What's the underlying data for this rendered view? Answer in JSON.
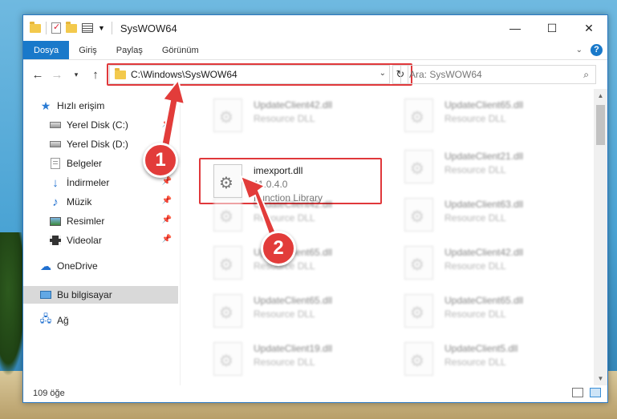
{
  "window": {
    "title": "SysWOW64",
    "minimize": "—",
    "maximize": "☐",
    "close": "✕"
  },
  "ribbon": {
    "tabs": [
      "Dosya",
      "Giriş",
      "Paylaş",
      "Görünüm"
    ]
  },
  "nav": {
    "address": "C:\\Windows\\SysWOW64",
    "search_placeholder": "Ara: SysWOW64"
  },
  "sidebar": {
    "items": [
      {
        "label": "Hızlı erişim",
        "icon": "star-icon"
      },
      {
        "label": "Yerel Disk (C:)",
        "icon": "disk-icon"
      },
      {
        "label": "Yerel Disk (D:)",
        "icon": "disk-icon"
      },
      {
        "label": "Belgeler",
        "icon": "documents-icon"
      },
      {
        "label": "İndirmeler",
        "icon": "downloads-icon"
      },
      {
        "label": "Müzik",
        "icon": "music-icon"
      },
      {
        "label": "Resimler",
        "icon": "pictures-icon"
      },
      {
        "label": "Videolar",
        "icon": "videos-icon"
      },
      {
        "label": "OneDrive",
        "icon": "cloud-icon"
      },
      {
        "label": "Bu bilgisayar",
        "icon": "computer-icon"
      },
      {
        "label": "Ağ",
        "icon": "network-icon"
      }
    ]
  },
  "files": {
    "left": [
      {
        "name": "UpdateClient42.dll",
        "sub": "Resource DLL"
      },
      {
        "name": "imexport.dll",
        "version": "11.0.4.0",
        "sub": "Function Library"
      },
      {
        "name": "UpdateClient42.dll",
        "sub": "Resource DLL"
      },
      {
        "name": "UpdateClient65.dll",
        "sub": "Resource DLL"
      },
      {
        "name": "UpdateClient65.dll",
        "sub": "Resource DLL"
      },
      {
        "name": "UpdateClient19.dll",
        "sub": "Resource DLL"
      }
    ],
    "right": [
      {
        "name": "UpdateClient65.dll",
        "sub": "Resource DLL"
      },
      {
        "name": "UpdateClient21.dll",
        "sub": "Resource DLL"
      },
      {
        "name": "UpdateClient63.dll",
        "sub": "Resource DLL"
      },
      {
        "name": "UpdateClient42.dll",
        "sub": "Resource DLL"
      },
      {
        "name": "UpdateClient65.dll",
        "sub": "Resource DLL"
      },
      {
        "name": "UpdateClient5.dll",
        "sub": "Resource DLL"
      }
    ]
  },
  "status": {
    "count": "109 öğe"
  },
  "annotations": {
    "badge1": "1",
    "badge2": "2"
  },
  "colors": {
    "accent": "#1979ca",
    "highlight": "#e0383b"
  }
}
